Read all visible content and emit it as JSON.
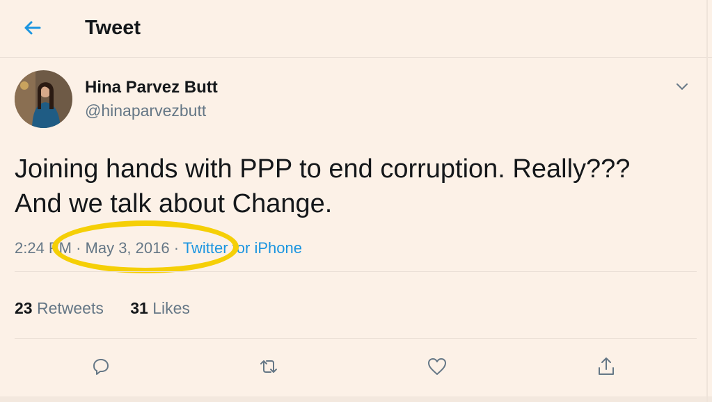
{
  "header": {
    "title": "Tweet"
  },
  "tweet": {
    "author_name": "Hina Parvez Butt",
    "author_handle": "@hinaparvezbutt",
    "text_line1": "Joining hands with PPP to end corruption. Really???",
    "text_line2": "And we talk about Change.",
    "time": "2:24 PM",
    "date": "May 3, 2016",
    "source": "Twitter for iPhone",
    "retweets_count": "23",
    "retweets_label": "Retweets",
    "likes_count": "31",
    "likes_label": "Likes"
  },
  "colors": {
    "background": "#fcf1e7",
    "accent": "#1b95e0",
    "highlight": "#f5cf06"
  },
  "icons": [
    "back-arrow-icon",
    "chevron-down-icon",
    "reply-icon",
    "retweet-icon",
    "like-icon",
    "share-icon"
  ]
}
